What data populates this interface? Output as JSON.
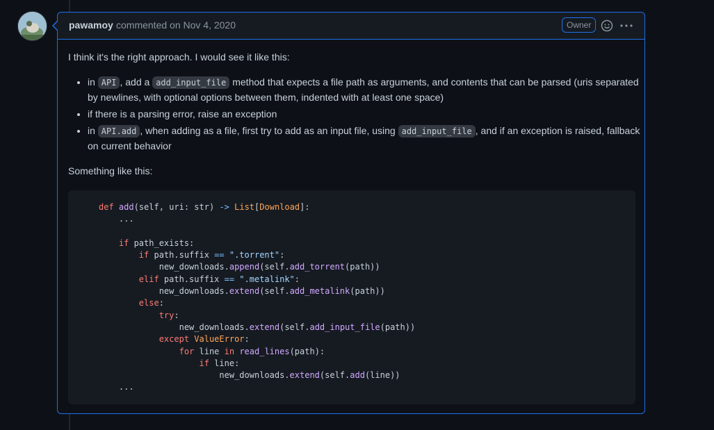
{
  "comment": {
    "author": "pawamoy",
    "action": "commented on",
    "date": "Nov 4, 2020",
    "badge": "Owner",
    "intro": "I think it's the right approach. I would see it like this:",
    "bullets": [
      {
        "t1": "in ",
        "c1": "API",
        "t2": ", add a ",
        "c2": "add_input_file",
        "t3": " method that expects a file path as arguments, and contents that can be parsed (uris separated by newlines, with optional options between them, indented with at least one space)"
      },
      {
        "t1": "if there is a parsing error, raise an exception"
      },
      {
        "t1": "in ",
        "c1": "API.add",
        "t2": ", when adding as a file, first try to add as an input file, using ",
        "c2": "add_input_file",
        "t3": ", and if an exception is raised, fallback on current behavior"
      }
    ],
    "outro": "Something like this:",
    "code": {
      "l1": {
        "k": "def",
        "f": "add",
        "a": "(self, uri: str) ",
        "o": "->",
        "c1": "List",
        "b1": "[",
        "c2": "Download",
        "b2": "]:"
      },
      "l2": "    ...",
      "l4": {
        "i": "    ",
        "k": "if",
        "r": " path_exists:"
      },
      "l5": {
        "i": "        ",
        "k": "if",
        "r1": " path.suffix ",
        "o": "==",
        "s": " \".torrent\"",
        "r2": ":"
      },
      "l6": {
        "i": "            new_downloads.",
        "f1": "append",
        "r1": "(self.",
        "f2": "add_torrent",
        "r2": "(path))"
      },
      "l7": {
        "i": "        ",
        "k": "elif",
        "r1": " path.suffix ",
        "o": "==",
        "s": " \".metalink\"",
        "r2": ":"
      },
      "l8": {
        "i": "            new_downloads.",
        "f1": "extend",
        "r1": "(self.",
        "f2": "add_metalink",
        "r2": "(path))"
      },
      "l9": {
        "i": "        ",
        "k": "else",
        "r": ":"
      },
      "l10": {
        "i": "            ",
        "k": "try",
        "r": ":"
      },
      "l11": {
        "i": "                new_downloads.",
        "f1": "extend",
        "r1": "(self.",
        "f2": "add_input_file",
        "r2": "(path))"
      },
      "l12": {
        "i": "            ",
        "k": "except",
        "c": " ValueError",
        "r": ":"
      },
      "l13": {
        "i": "                ",
        "k1": "for",
        "r1": " line ",
        "k2": "in",
        "f": " read_lines",
        "r2": "(path):"
      },
      "l14": {
        "i": "                    ",
        "k": "if",
        "r": " line:"
      },
      "l15": {
        "i": "                        new_downloads.",
        "f1": "extend",
        "r1": "(self.",
        "f2": "add",
        "r2": "(line))"
      },
      "l16": "    ..."
    }
  }
}
